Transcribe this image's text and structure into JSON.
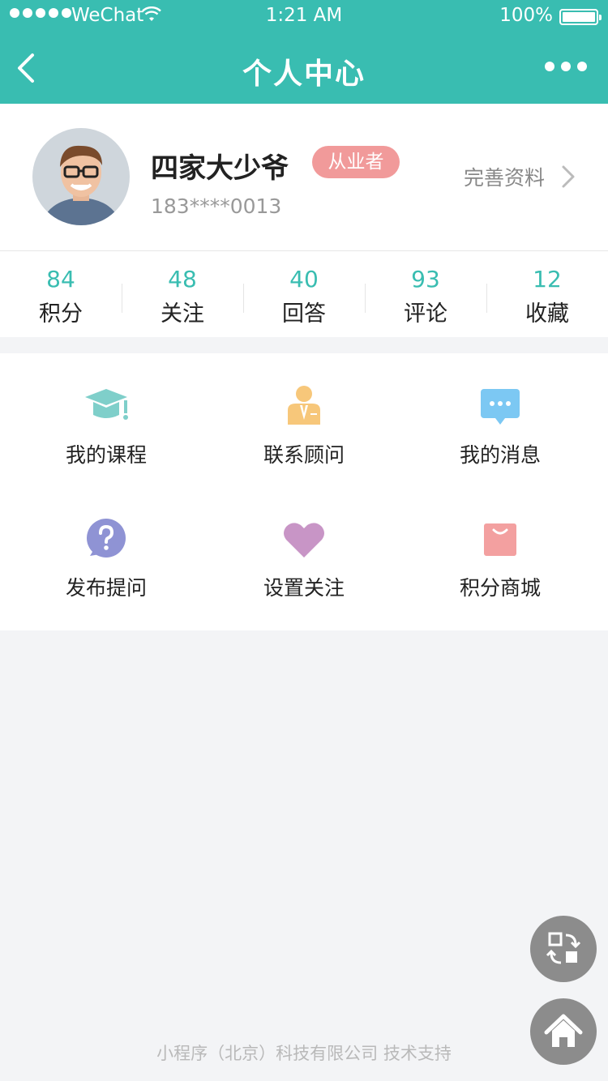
{
  "status_bar": {
    "carrier": "WeChat",
    "time": "1:21 AM",
    "battery": "100%"
  },
  "nav": {
    "title": "个人中心"
  },
  "profile": {
    "name": "四家大少爷",
    "badge": "从业者",
    "phone": "183****0013",
    "edit_label": "完善资料"
  },
  "stats": [
    {
      "value": "84",
      "label": "积分"
    },
    {
      "value": "48",
      "label": "关注"
    },
    {
      "value": "40",
      "label": "回答"
    },
    {
      "value": "93",
      "label": "评论"
    },
    {
      "value": "12",
      "label": "收藏"
    }
  ],
  "menu": [
    {
      "label": "我的课程",
      "icon": "graduation-cap-icon",
      "color": "#7fcfca"
    },
    {
      "label": "联系顾问",
      "icon": "advisor-icon",
      "color": "#f7c77a"
    },
    {
      "label": "我的消息",
      "icon": "chat-bubble-icon",
      "color": "#7cc8f3"
    },
    {
      "label": "发布提问",
      "icon": "question-icon",
      "color": "#8f93d4"
    },
    {
      "label": "设置关注",
      "icon": "heart-icon",
      "color": "#c895c6"
    },
    {
      "label": "积分商城",
      "icon": "shopping-bag-icon",
      "color": "#f3a0a0"
    }
  ],
  "footer": {
    "text": "小程序（北京）科技有限公司 技术支持"
  },
  "colors": {
    "primary": "#39bdb1",
    "badge": "#f19a9a"
  }
}
